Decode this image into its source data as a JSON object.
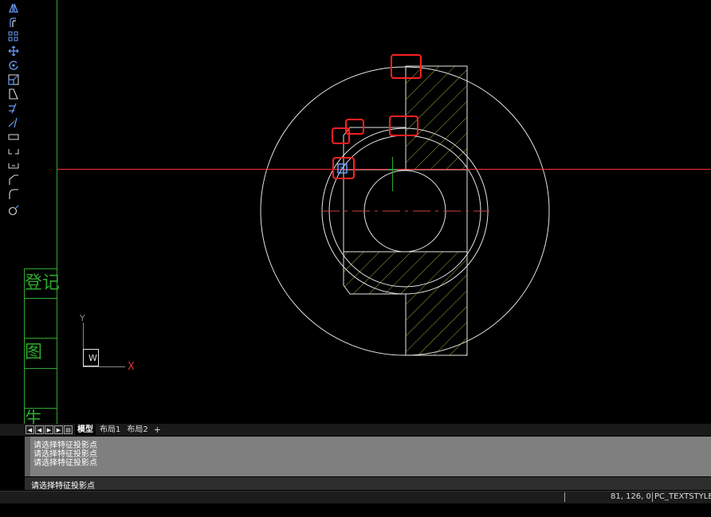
{
  "toolbar": {
    "tools": [
      {
        "icon": "mirror-icon"
      },
      {
        "icon": "offset-icon"
      },
      {
        "icon": "array-icon"
      },
      {
        "icon": "move-icon"
      },
      {
        "icon": "rotate-icon"
      },
      {
        "icon": "scale-icon"
      },
      {
        "icon": "stretch-icon"
      },
      {
        "icon": "trim-icon"
      },
      {
        "icon": "extend-icon"
      },
      {
        "icon": "break-icon"
      },
      {
        "icon": "break-at-point-icon"
      },
      {
        "icon": "join-icon"
      },
      {
        "icon": "chamfer-icon"
      },
      {
        "icon": "fillet-icon"
      },
      {
        "icon": "explode-icon"
      }
    ]
  },
  "title_block": {
    "label_1": "登记",
    "label_2": "图",
    "label_3": "生"
  },
  "ucs": {
    "x_label": "X",
    "y_label": "Y",
    "w_label": "W"
  },
  "tabs": {
    "items": [
      {
        "label": "模型",
        "active": true
      },
      {
        "label": "布局1",
        "active": false
      },
      {
        "label": "布局2",
        "active": false
      }
    ],
    "add_label": "+"
  },
  "command": {
    "history": [
      "请选择特征投影点",
      "请选择特征投影点",
      "请选择特征投影点"
    ],
    "prompt": "请选择特征投影点"
  },
  "status": {
    "coordinates": "81, 126, 0",
    "text_style": "PC_TEXTSTYLE"
  },
  "colors": {
    "drawing_line": "#e6e6e6",
    "hatch": "#b8b84a",
    "crosshair": "#ff3030",
    "snap_marker": "#ff2020",
    "grip": "#6aa0ff",
    "title_block": "#2ea82e"
  }
}
